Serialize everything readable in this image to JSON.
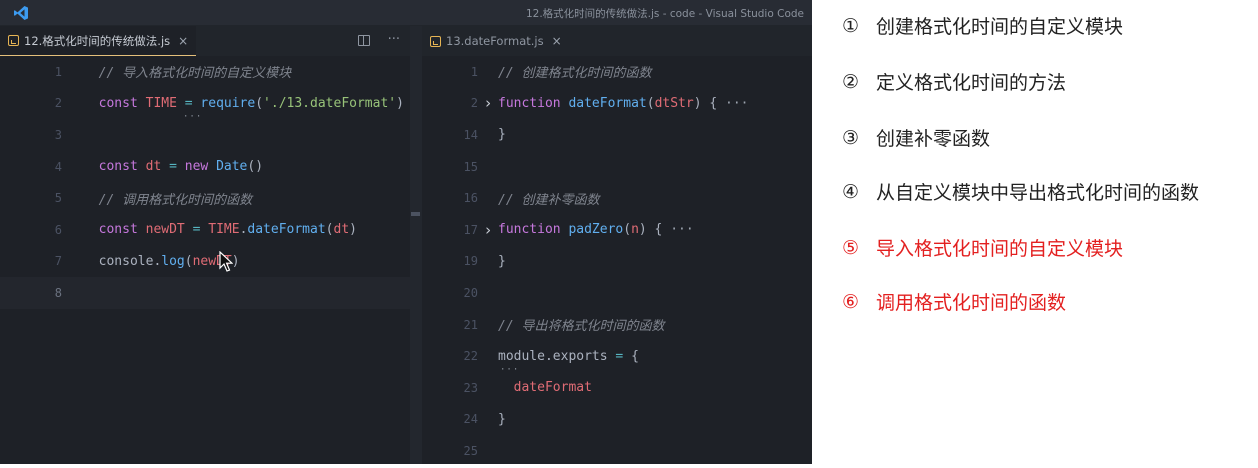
{
  "window": {
    "title": "12.格式化时间的传统做法.js - code - Visual Studio Code"
  },
  "left_editor": {
    "tab": {
      "label": "12.格式化时间的传统做法.js",
      "close": "×"
    },
    "actions": {
      "more": "···"
    },
    "lines": [
      {
        "num": "1",
        "tokens": [
          {
            "t": "  // 导入格式化时间的自定义模块",
            "c": "c-comment"
          }
        ]
      },
      {
        "num": "2",
        "tokens": [
          {
            "t": "  const ",
            "c": "c-key"
          },
          {
            "t": "TIME",
            "c": "c-var"
          },
          {
            "t": " = ",
            "c": "c-op"
          },
          {
            "t": "require",
            "c": "c-fn"
          },
          {
            "t": "(",
            "c": "c-plain"
          },
          {
            "t": "'./13.dateFormat'",
            "c": "c-str"
          },
          {
            "t": ")",
            "c": "c-plain"
          }
        ]
      },
      {
        "num": "3",
        "tokens": []
      },
      {
        "num": "4",
        "tokens": [
          {
            "t": "  const ",
            "c": "c-key"
          },
          {
            "t": "dt",
            "c": "c-var"
          },
          {
            "t": " = ",
            "c": "c-op"
          },
          {
            "t": "new ",
            "c": "c-key"
          },
          {
            "t": "Date",
            "c": "c-fn"
          },
          {
            "t": "()",
            "c": "c-plain"
          }
        ]
      },
      {
        "num": "5",
        "tokens": [
          {
            "t": "  // 调用格式化时间的函数",
            "c": "c-comment"
          }
        ]
      },
      {
        "num": "6",
        "tokens": [
          {
            "t": "  const ",
            "c": "c-key"
          },
          {
            "t": "newDT",
            "c": "c-var"
          },
          {
            "t": " = ",
            "c": "c-op"
          },
          {
            "t": "TIME",
            "c": "c-var"
          },
          {
            "t": ".",
            "c": "c-plain"
          },
          {
            "t": "dateFormat",
            "c": "c-fn"
          },
          {
            "t": "(",
            "c": "c-plain"
          },
          {
            "t": "dt",
            "c": "c-var"
          },
          {
            "t": ")",
            "c": "c-plain"
          }
        ]
      },
      {
        "num": "7",
        "tokens": [
          {
            "t": "  console",
            "c": "c-plain"
          },
          {
            "t": ".",
            "c": "c-plain"
          },
          {
            "t": "log",
            "c": "c-fn"
          },
          {
            "t": "(",
            "c": "c-plain"
          },
          {
            "t": "newDT",
            "c": "c-var"
          },
          {
            "t": ")",
            "c": "c-plain"
          }
        ]
      },
      {
        "num": "8",
        "tokens": [],
        "current": true
      }
    ]
  },
  "right_editor": {
    "tab": {
      "label": "13.dateFormat.js",
      "close": "×"
    },
    "lines": [
      {
        "num": "1",
        "tokens": [
          {
            "t": "// 创建格式化时间的函数",
            "c": "c-comment"
          }
        ]
      },
      {
        "num": "2",
        "fold": "›",
        "tokens": [
          {
            "t": "function ",
            "c": "c-key"
          },
          {
            "t": "dateFormat",
            "c": "c-fn"
          },
          {
            "t": "(",
            "c": "c-plain"
          },
          {
            "t": "dtStr",
            "c": "c-param"
          },
          {
            "t": ") {",
            "c": "c-plain"
          },
          {
            "t": " ···",
            "c": "fold-dots"
          }
        ]
      },
      {
        "num": "14",
        "tokens": [
          {
            "t": "}",
            "c": "c-plain"
          }
        ]
      },
      {
        "num": "15",
        "tokens": []
      },
      {
        "num": "16",
        "tokens": [
          {
            "t": "// 创建补零函数",
            "c": "c-comment"
          }
        ]
      },
      {
        "num": "17",
        "fold": "›",
        "tokens": [
          {
            "t": "function ",
            "c": "c-key"
          },
          {
            "t": "padZero",
            "c": "c-fn"
          },
          {
            "t": "(",
            "c": "c-plain"
          },
          {
            "t": "n",
            "c": "c-param"
          },
          {
            "t": ") {",
            "c": "c-plain"
          },
          {
            "t": " ···",
            "c": "fold-dots"
          }
        ]
      },
      {
        "num": "19",
        "tokens": [
          {
            "t": "}",
            "c": "c-plain"
          }
        ]
      },
      {
        "num": "20",
        "tokens": []
      },
      {
        "num": "21",
        "tokens": [
          {
            "t": "// 导出将格式化时间的函数",
            "c": "c-comment"
          }
        ]
      },
      {
        "num": "22",
        "tokens": [
          {
            "t": "module",
            "c": "c-plain"
          },
          {
            "t": ".",
            "c": "c-plain"
          },
          {
            "t": "exports",
            "c": "c-plain"
          },
          {
            "t": " = ",
            "c": "c-op"
          },
          {
            "t": "{",
            "c": "c-plain"
          }
        ]
      },
      {
        "num": "23",
        "tokens": [
          {
            "t": "  dateFormat",
            "c": "c-var"
          }
        ]
      },
      {
        "num": "24",
        "tokens": [
          {
            "t": "}",
            "c": "c-plain"
          }
        ]
      },
      {
        "num": "25",
        "tokens": []
      }
    ]
  },
  "notes": [
    {
      "num": "①",
      "text": "创建格式化时间的自定义模块",
      "color": "#222222"
    },
    {
      "num": "②",
      "text": "定义格式化时间的方法",
      "color": "#222222"
    },
    {
      "num": "③",
      "text": "创建补零函数",
      "color": "#222222"
    },
    {
      "num": "④",
      "text": "从自定义模块中导出格式化时间的函数",
      "color": "#222222"
    },
    {
      "num": "⑤",
      "text": "导入格式化时间的自定义模块",
      "color": "#e32020"
    },
    {
      "num": "⑥",
      "text": "调用格式化时间的函数",
      "color": "#e32020"
    }
  ],
  "icons": {
    "app": "vscode-icon",
    "file": "js-file-icon",
    "split": "split-editor-icon",
    "cursor": "mouse-pointer-icon"
  }
}
